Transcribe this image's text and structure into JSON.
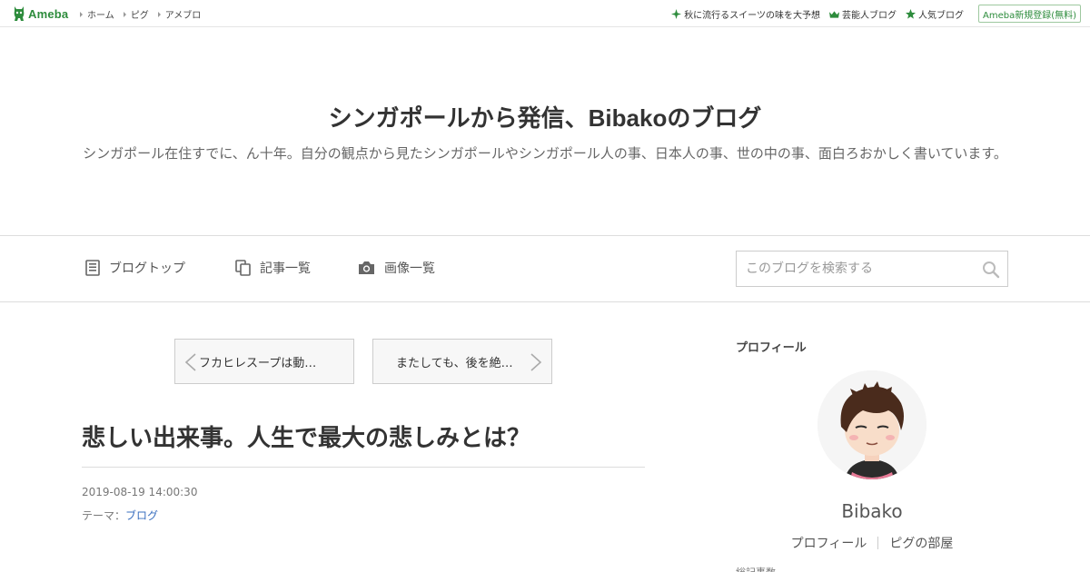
{
  "topbar": {
    "logo_text": "Ameba",
    "nav": [
      "ホーム",
      "ピグ",
      "アメブロ"
    ],
    "right_links": [
      {
        "label": "秋に流行るスイーツの味を大予想",
        "icon": "sparkle-icon",
        "color": "#2d8c3c"
      },
      {
        "label": "芸能人ブログ",
        "icon": "crown-icon",
        "color": "#2d8c3c"
      },
      {
        "label": "人気ブログ",
        "icon": "star-icon",
        "color": "#2d8c3c"
      }
    ],
    "register_label": "Ameba新規登録(無料)"
  },
  "header": {
    "title": "シンガポールから発信、Bibakoのブログ",
    "description": "シンガポール在住すでに、ん十年。自分の観点から見たシンガポールやシンガポール人の事、日本人の事、世の中の事、面白ろおかしく書いています。"
  },
  "nav": {
    "blog_top": "ブログトップ",
    "articles": "記事一覧",
    "images": "画像一覧",
    "search_placeholder": "このブログを検索する"
  },
  "pager": {
    "prev": "フカヒレスープは動…",
    "next": "またしても、後を絶…"
  },
  "article": {
    "title": "悲しい出来事。人生で最大の悲しみとは？",
    "date": "2019-08-19 14:00:30",
    "theme_label": "テーマ：",
    "theme": "ブログ"
  },
  "sidebar": {
    "heading": "プロフィール",
    "name": "Bibako",
    "links": [
      "プロフィール",
      "ピグの部屋"
    ],
    "cut_text": "総記事数"
  },
  "colors": {
    "brand": "#2d8c3c",
    "link": "#3a6fbf"
  }
}
